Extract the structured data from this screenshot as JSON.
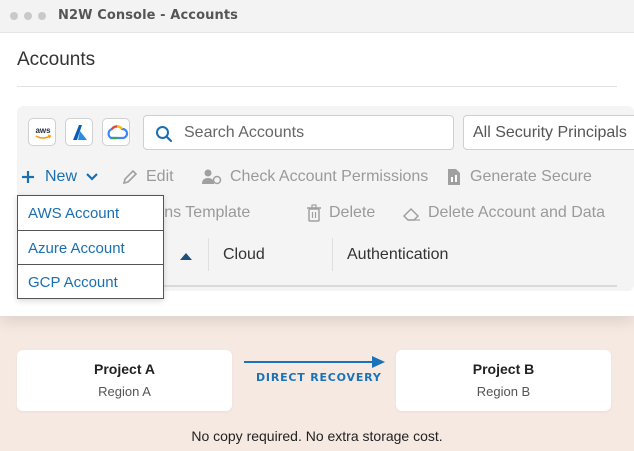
{
  "window": {
    "title": "N2W Console - Accounts"
  },
  "page": {
    "title": "Accounts"
  },
  "filters": {
    "search_placeholder": "Search Accounts",
    "security_filter": "All Security Principals",
    "cloud_buttons": [
      "aws-icon",
      "azure-icon",
      "gcp-icon"
    ]
  },
  "toolbar": {
    "new_label": "New",
    "edit_label": "Edit",
    "check_permissions_label": "Check Account Permissions",
    "generate_label": "Generate Secure",
    "permissions_template_label": "Permissions Template",
    "delete_label": "Delete",
    "delete_account_label": "Delete Account and Data"
  },
  "new_menu": {
    "items": [
      "AWS Account",
      "Azure Account",
      "GCP Account"
    ]
  },
  "table": {
    "columns": [
      "Cloud",
      "Authentication"
    ]
  },
  "diagram": {
    "source": {
      "title": "Project A",
      "region": "Region A"
    },
    "target": {
      "title": "Project B",
      "region": "Region B"
    },
    "arrow_label": "DIRECT RECOVERY",
    "footer": "No copy required. No extra storage cost."
  },
  "colors": {
    "accent": "#1a6fb3",
    "background": "#f6e9e2",
    "panel": "#f4f4f4"
  }
}
